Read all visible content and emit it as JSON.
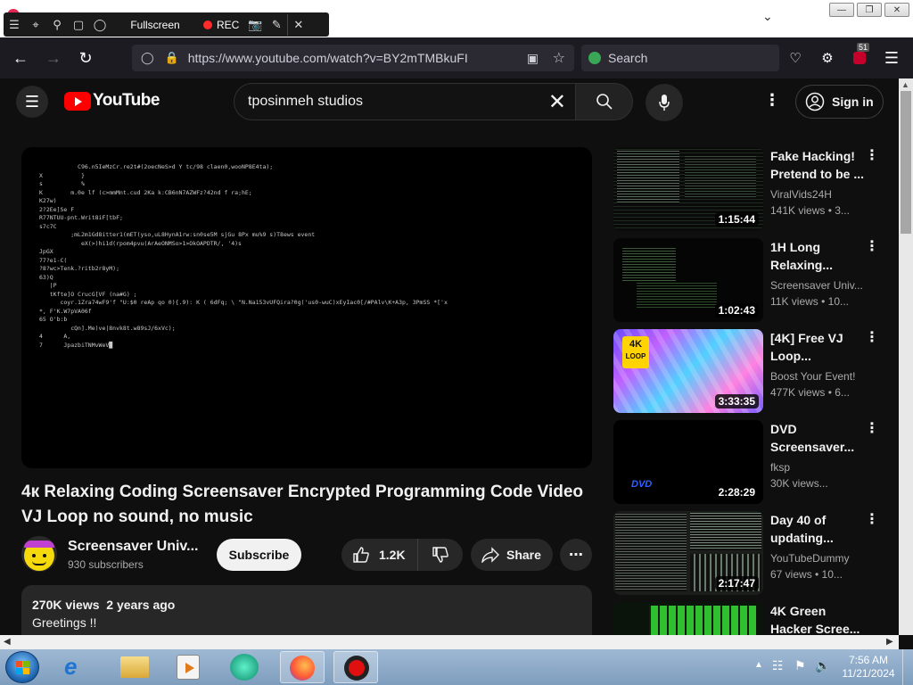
{
  "recorder": {
    "fullscreen_label": "Fullscreen",
    "rec_label": "REC"
  },
  "browser": {
    "url": "https://www.youtube.com/watch?v=BY2mTMBkuFI",
    "search_placeholder": "Search",
    "notification_count": "51"
  },
  "youtube": {
    "logo_text": "YouTube",
    "search_value": "tposinmeh studios",
    "sign_in_label": "Sign in"
  },
  "video": {
    "title": "4к Relaxing Coding Screensaver Encrypted Programming Code Video VJ Loop no sound, no music",
    "channel_name": "Screensaver Univ...",
    "subscribers": "930 subscribers",
    "subscribe_label": "Subscribe",
    "likes": "1.2K",
    "share_label": "Share",
    "views": "270K views",
    "age": "2 years ago",
    "description": "Greetings !!"
  },
  "recommendations": [
    {
      "title": "Fake Hacking! Pretend to be ...",
      "channel": "ViralVids24H",
      "meta": "141K views  • 3...",
      "duration": "1:15:44",
      "thumb": "code"
    },
    {
      "title": "1H Long Relaxing...",
      "channel": "Screensaver Univ...",
      "meta": "11K views  • 10...",
      "duration": "1:02:43",
      "thumb": "code2"
    },
    {
      "title": "[4K] Free VJ Loop...",
      "channel": "Boost Your Event!",
      "meta": "477K views  • 6...",
      "duration": "3:33:35",
      "thumb": "colorful"
    },
    {
      "title": "DVD Screensaver...",
      "channel": "fksp",
      "meta": "30K views...",
      "duration": "2:28:29",
      "thumb": "dvd"
    },
    {
      "title": "Day 40 of updating...",
      "channel": "YouTubeDummy",
      "meta": "67 views  • 10...",
      "duration": "2:17:47",
      "thumb": "multi"
    },
    {
      "title": "4K Green Hacker Scree...",
      "channel": "",
      "meta": "",
      "duration": "",
      "thumb": "green"
    }
  ],
  "taskbar": {
    "time": "7:56 AM",
    "date": "11/21/2024"
  },
  "colors": {
    "youtube_red": "#ff0000",
    "rec_red": "#ff2b2b",
    "subscribe_bg": "#f1f1f1"
  }
}
